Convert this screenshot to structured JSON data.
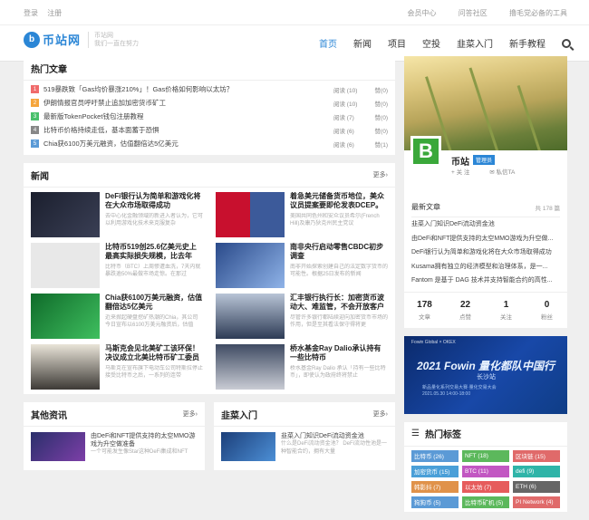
{
  "topbar": {
    "login": "登录",
    "register": "注册",
    "links": [
      "会员中心",
      "问答社区",
      "撸毛党必备的工具"
    ]
  },
  "logo": {
    "name": "币站网",
    "slogan1": "币站网",
    "slogan2": "我们一直在努力"
  },
  "nav": [
    "首页",
    "新闻",
    "项目",
    "空投",
    "韭菜入门",
    "新手教程"
  ],
  "hot": {
    "title": "热门文章",
    "items": [
      {
        "n": "1",
        "color": "#f06b6b",
        "title": "519暴跌致「Gas均价暴涨210%」！Gas价格如何影响以太坊？",
        "read": "阅读 (10)",
        "like": "赞(0)"
      },
      {
        "n": "2",
        "color": "#f5a53c",
        "title": "伊朗情报官员呼吁禁止追加加密货币矿工",
        "read": "阅读 (10)",
        "like": "赞(0)"
      },
      {
        "n": "3",
        "color": "#49c06b",
        "title": "最新版TokenPocket钱包注册教程",
        "read": "阅读 (7)",
        "like": "赞(0)"
      },
      {
        "n": "4",
        "color": "#888888",
        "title": "比特币价格持续走低，基本面蓄于恐惧",
        "read": "阅读 (6)",
        "like": "赞(0)"
      },
      {
        "n": "5",
        "color": "#5b9ad6",
        "title": "Chia获6100万美元融资，估值翻倍达5亿美元",
        "read": "阅读 (6)",
        "like": "赞(1)"
      }
    ]
  },
  "news": {
    "title": "新闻",
    "more": "更多›",
    "items": [
      {
        "title": "DeFi银行认为简单和游戏化将在大众市场取得成功",
        "desc": "去中心化金融领域的新进入者认为，它可以利用游戏化技术来克服复杂",
        "img": "defi"
      },
      {
        "title": "着急美元储备货币地位，美众议员提案要即伦发表DCEP。",
        "desc": "美国共同色州和安众议员希尔(French Hill)及康乃狄克州民主党议",
        "img": "flags"
      },
      {
        "title": "比特币519创25.6亿美元史上最高实际损失规模，比去年312高",
        "desc": "比特币（BTC）上周惨遭血洗，7天内就暴跌逾50%最做市场走惊。在那过",
        "img": "gray"
      },
      {
        "title": "南非央行启动零售CBDC初步调查",
        "desc": "南非开始探索创建自己的法定数字货币的可能性。根据25日发布的新闻",
        "img": "coins"
      },
      {
        "title": "Chia获6100万美元融资，估值翻倍达5亿美元",
        "desc": "近来掀起硬盘挖矿热潮的Chia，其公司今日宣布以6100万美元融资后，估值",
        "img": "chia"
      },
      {
        "title": "汇丰银行执行长：加密货币波动大、难监管，不会开放客户",
        "desc": "尽管许多银行都陆续迎向加密货币市场的作用，但是至其看法保守得将更",
        "img": "man1"
      },
      {
        "title": "马斯克会见北美矿工该环保！决议成立北美比特币矿工委员会，",
        "desc": "马斯克在宣布旗下电动车公司特斯拉停止接受比特币之后，一系列的连带",
        "img": "musk"
      },
      {
        "title": "桥水基金Ray Dalio承认持有一些比特币",
        "desc": "桥水基金Ray Dalio 承认「持有一些比特币」，即使认为政府终将禁止",
        "img": "dalio"
      }
    ]
  },
  "other": {
    "title": "其他资讯",
    "more": "更多›",
    "item": "由DeFi和NFT提供支持的太空MMO游戏为升空做准备",
    "desc": "一个可能发生像Star这种DeFi集成和NFT"
  },
  "jiucai": {
    "title": "韭菜入门",
    "more": "更多›",
    "item": "韭菜入门知识DeFi流动资金池",
    "desc": "什么是DeFi流动资金池？ DeFi流动性池是一种智能合约，拥有大量"
  },
  "profile": {
    "name": "币站",
    "badge": "管理员",
    "follow": "关 注",
    "msg": "私信TA"
  },
  "latest": {
    "title": "最新文章",
    "count": "共 178 篇",
    "items": [
      "韭菜入门知识DeFi流动资金池",
      "由DeFi和NFT提供支持的太空MMO游戏为升空做...",
      "DeFi银行认为简单和游戏化将在大众市场取得成功",
      "Kusama拥有独立的经济模型和治理体系，是一...",
      "Fantom 是基于 DAG 技术并支持智能合约的高性..."
    ]
  },
  "stats": [
    {
      "v": "178",
      "l": "文章"
    },
    {
      "v": "22",
      "l": "点赞"
    },
    {
      "v": "1",
      "l": "关注"
    },
    {
      "v": "0",
      "l": "粉丝"
    }
  ],
  "ad": {
    "brand": "Fowin Global × OKEX",
    "title": "2021 Fowin 量化都队中国行",
    "city": "长沙站",
    "sub": "新品量化系列交易大赛·量化交易大会\n2021.05.30 14:00-18:00"
  },
  "tags": {
    "title": "热门标签",
    "items": [
      {
        "label": "比特币 (26)",
        "color": "#5b9ad6"
      },
      {
        "label": "NFT (18)",
        "color": "#5cb85c"
      },
      {
        "label": "区块链 (15)",
        "color": "#e06a6a"
      },
      {
        "label": "加密货币 (15)",
        "color": "#4a9fd8"
      },
      {
        "label": "BTC (11)",
        "color": "#c257c2"
      },
      {
        "label": "defi (9)",
        "color": "#2fb4a8"
      },
      {
        "label": "韩影抖 (7)",
        "color": "#e0924a"
      },
      {
        "label": "以太坊 (7)",
        "color": "#e65c5c"
      },
      {
        "label": "ETH (6)",
        "color": "#666666"
      },
      {
        "label": "狗狗币 (5)",
        "color": "#5b9ad6"
      },
      {
        "label": "比特币矿机 (5)",
        "color": "#5cb85c"
      },
      {
        "label": "PI Network (4)",
        "color": "#e06a6a"
      }
    ]
  }
}
